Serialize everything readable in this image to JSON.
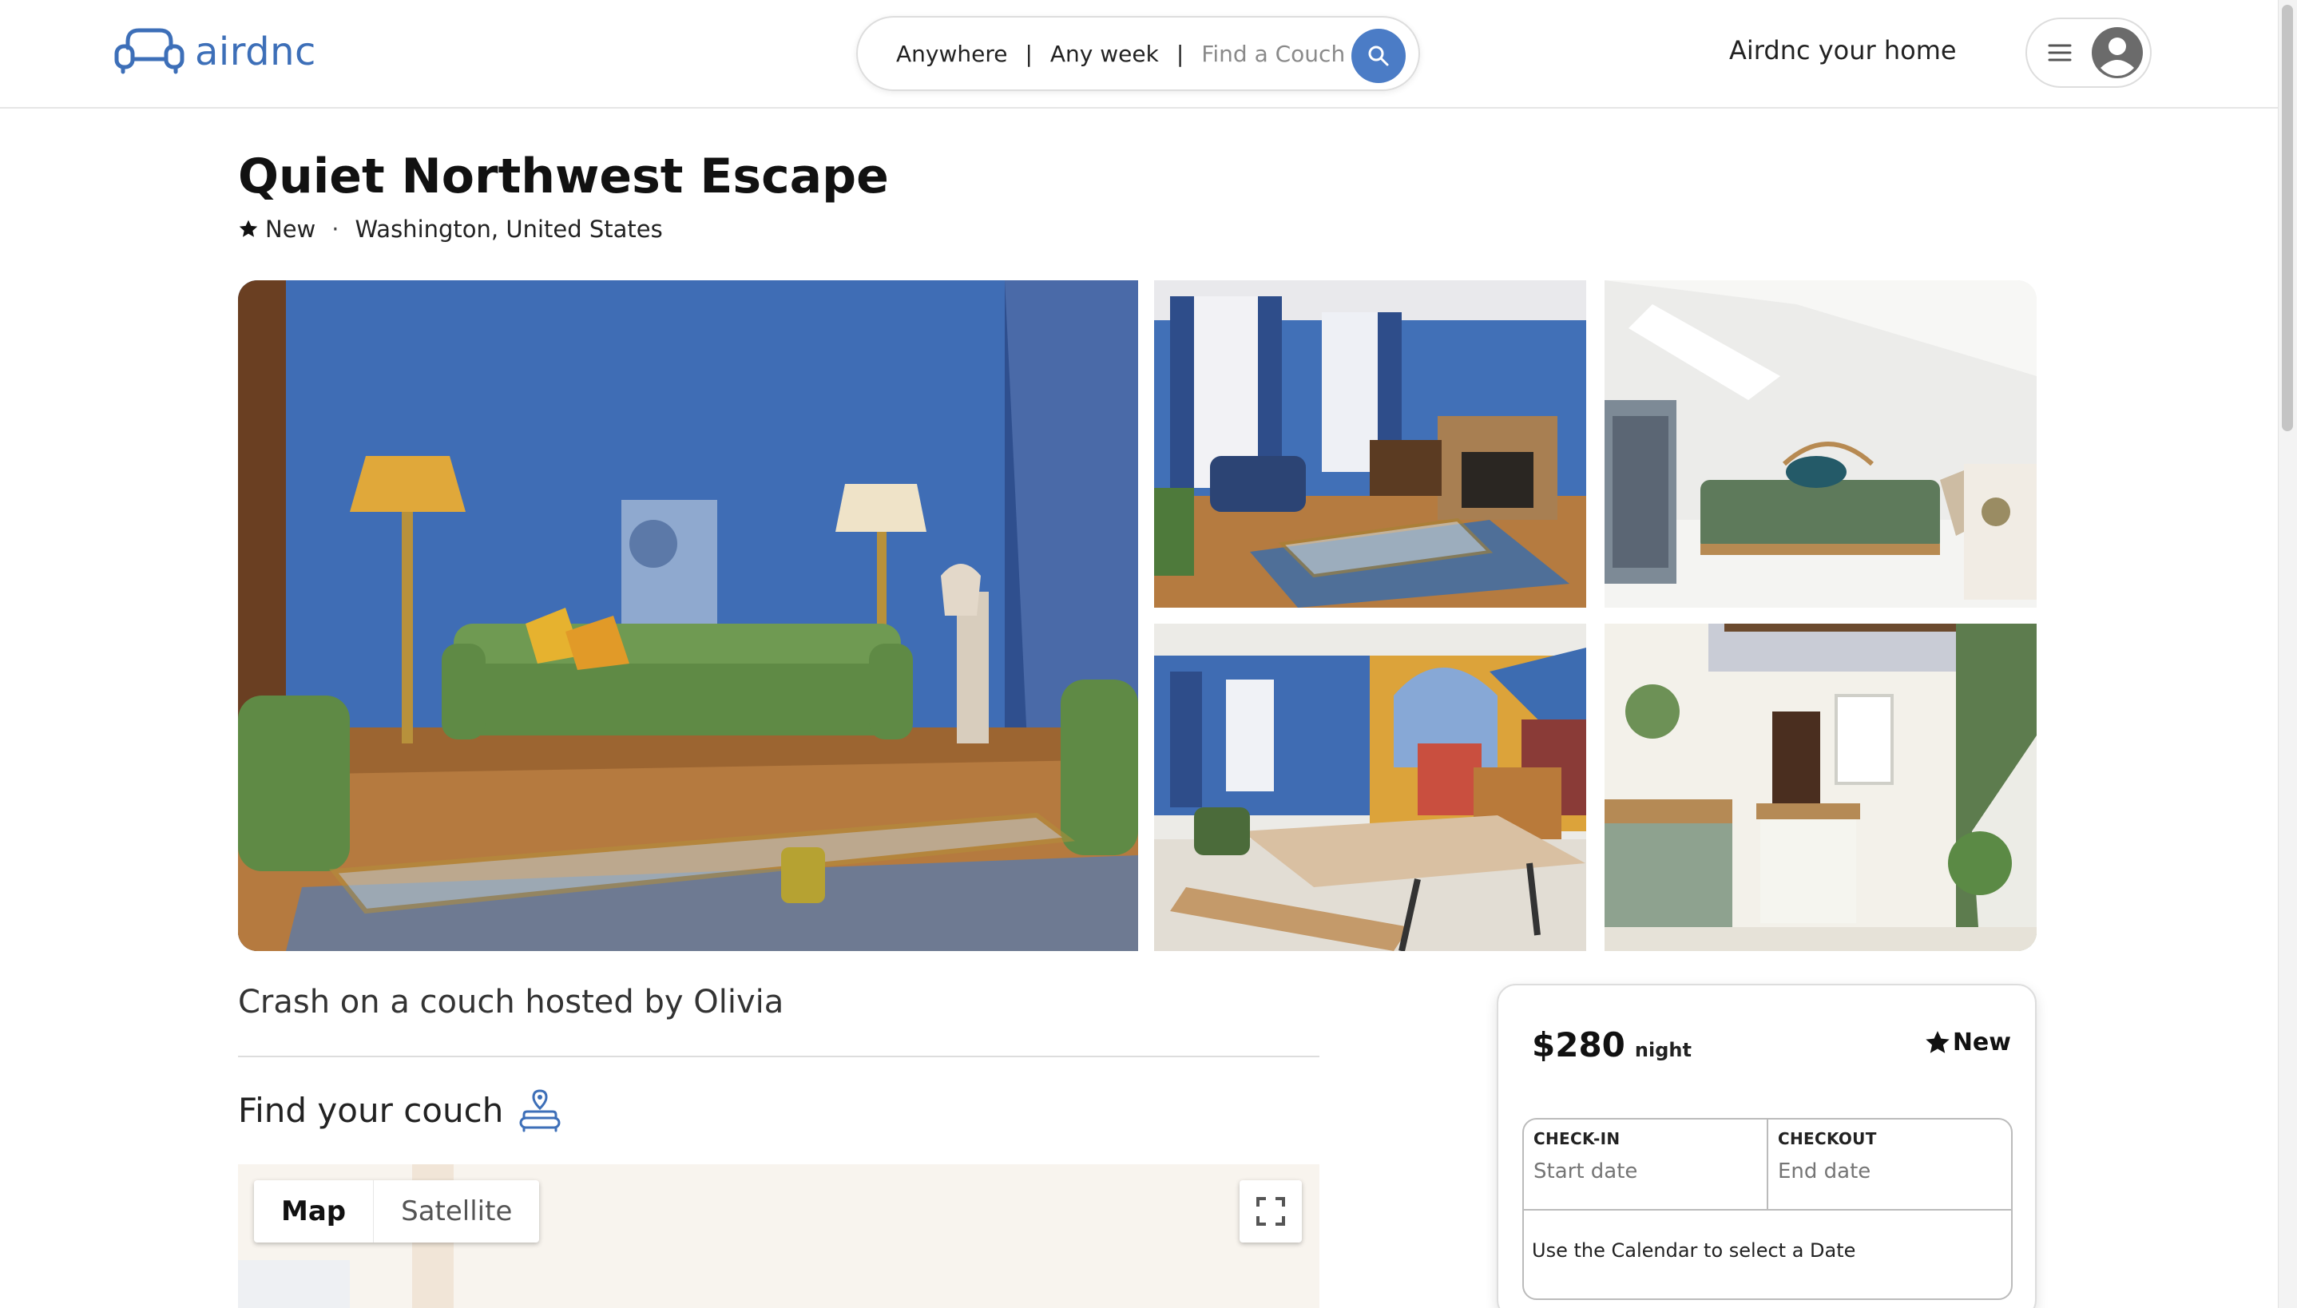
{
  "header": {
    "logo_text": "airdnc",
    "search": {
      "location": "Anywhere",
      "separator_1": "|",
      "week": "Any week",
      "separator_2": "|",
      "placeholder": "Find a Couch"
    },
    "host_link": "Airdnc your home",
    "icons": [
      "couch-logo-icon",
      "search-icon",
      "hamburger-menu-icon",
      "user-avatar-icon"
    ]
  },
  "listing": {
    "title": "Quiet Northwest Escape",
    "rating_label": "New",
    "separator": "·",
    "location": "Washington, United States",
    "photos": [
      "living-room-main-photo",
      "living-room-fireplace-photo",
      "bedroom-photo",
      "dining-room-photo",
      "kitchen-photo"
    ],
    "host_line": "Crash on a couch hosted by Olivia",
    "find_heading": "Find your couch"
  },
  "map": {
    "tabs": [
      "Map",
      "Satellite"
    ],
    "active_tab": "Map"
  },
  "booking": {
    "price": "$280",
    "per": "night",
    "rating_label": "New",
    "checkin_label": "CHECK-IN",
    "checkin_placeholder": "Start date",
    "checkout_label": "CHECKOUT",
    "checkout_placeholder": "End date",
    "hint": "Use the Calendar to select a Date"
  },
  "colors": {
    "brand_blue": "#3d6fb8",
    "search_button": "#4b7cc6",
    "wall_blue": "#3f6db5",
    "sofa_green": "#6f9a52"
  }
}
